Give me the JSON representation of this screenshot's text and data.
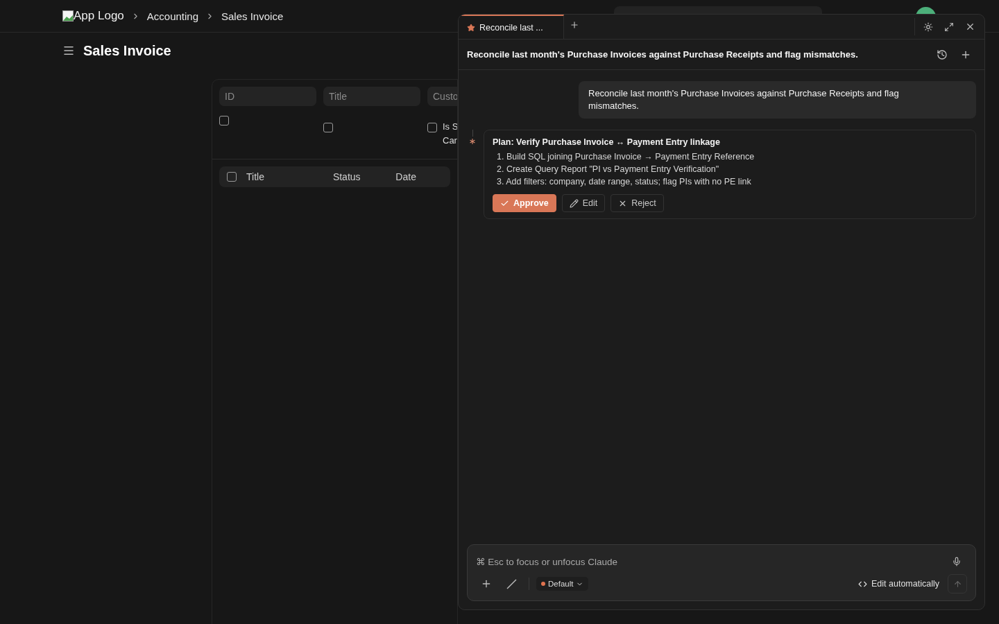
{
  "header": {
    "logo_alt": "App Logo",
    "breadcrumbs": [
      "Accounting",
      "Sales Invoice"
    ]
  },
  "page": {
    "title": "Sales Invoice"
  },
  "filters": {
    "fields": [
      {
        "placeholder": "ID"
      },
      {
        "placeholder": "Title"
      },
      {
        "placeholder": "Custo"
      }
    ],
    "checks": [
      {
        "checked": false
      },
      {
        "checked": false
      },
      {
        "checked": false,
        "label_lines": [
          "Is S",
          "Car"
        ]
      }
    ]
  },
  "table": {
    "all_checked": false,
    "columns": [
      "Title",
      "Status",
      "Date"
    ]
  },
  "assistant": {
    "tabs": [
      {
        "label": "Reconcile last ...",
        "selected": true
      }
    ],
    "title": "Reconcile last month's Purchase Invoices against Purchase Receipts and flag mismatches.",
    "messages": [
      {
        "kind": "user",
        "text": "Reconcile last month's Purchase Invoices against Purchase Receipts and flag mismatches."
      },
      {
        "kind": "plan",
        "title": "Plan: Verify Purchase Invoice ↔ Payment Entry linkage",
        "steps": [
          "1. Build SQL joining Purchase Invoice → Payment Entry Reference",
          "2. Create Query Report \"PI vs Payment Entry Verification\"",
          "3. Add filters: company, date range, status; flag PIs with no PE link"
        ],
        "actions": [
          {
            "kind": "approve",
            "label": "Approve"
          },
          {
            "kind": "edit",
            "label": "Edit"
          },
          {
            "kind": "reject",
            "label": "Reject"
          }
        ]
      }
    ],
    "composer": {
      "placeholder": "⌘ Esc to focus or unfocus Claude",
      "mode": {
        "label": "Default",
        "color": "#e0734f"
      },
      "edit_mode": "Edit automatically"
    }
  }
}
